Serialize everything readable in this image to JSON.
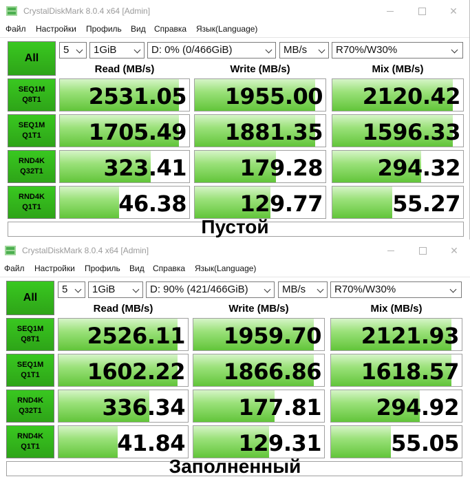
{
  "windows": [
    {
      "title": "CrystalDiskMark 8.0.4 x64 [Admin]",
      "menu": [
        "Файл",
        "Настройки",
        "Профиль",
        "Вид",
        "Справка",
        "Язык(Language)"
      ],
      "all_label": "All",
      "count": "5",
      "size": "1GiB",
      "drive": "D: 0% (0/466GiB)",
      "unit": "MB/s",
      "mix_mode": "R70%/W30%",
      "headers": [
        "Read (MB/s)",
        "Write (MB/s)",
        "Mix (MB/s)"
      ],
      "rows": [
        {
          "l1": "SEQ1M",
          "l2": "Q8T1",
          "read": "2531.05",
          "write": "1955.00",
          "mix": "2120.42",
          "fills": [
            0.92,
            0.92,
            0.92
          ]
        },
        {
          "l1": "SEQ1M",
          "l2": "Q1T1",
          "read": "1705.49",
          "write": "1881.35",
          "mix": "1596.33",
          "fills": [
            0.92,
            0.92,
            0.92
          ]
        },
        {
          "l1": "RND4K",
          "l2": "Q32T1",
          "read": "323.41",
          "write": "179.28",
          "mix": "294.32",
          "fills": [
            0.7,
            0.62,
            0.68
          ]
        },
        {
          "l1": "RND4K",
          "l2": "Q1T1",
          "read": "46.38",
          "write": "129.77",
          "mix": "55.27",
          "fills": [
            0.46,
            0.58,
            0.46
          ]
        }
      ],
      "overlay_text": "Пустой"
    },
    {
      "title": "CrystalDiskMark 8.0.4 x64 [Admin]",
      "menu": [
        "Файл",
        "Настройки",
        "Профиль",
        "Вид",
        "Справка",
        "Язык(Language)"
      ],
      "all_label": "All",
      "count": "5",
      "size": "1GiB",
      "drive": "D: 90% (421/466GiB)",
      "unit": "MB/s",
      "mix_mode": "R70%/W30%",
      "headers": [
        "Read (MB/s)",
        "Write (MB/s)",
        "Mix (MB/s)"
      ],
      "rows": [
        {
          "l1": "SEQ1M",
          "l2": "Q8T1",
          "read": "2526.11",
          "write": "1959.70",
          "mix": "2121.93",
          "fills": [
            0.92,
            0.92,
            0.92
          ]
        },
        {
          "l1": "SEQ1M",
          "l2": "Q1T1",
          "read": "1602.22",
          "write": "1866.86",
          "mix": "1618.57",
          "fills": [
            0.92,
            0.92,
            0.92
          ]
        },
        {
          "l1": "RND4K",
          "l2": "Q32T1",
          "read": "336.34",
          "write": "177.81",
          "mix": "294.92",
          "fills": [
            0.7,
            0.62,
            0.68
          ]
        },
        {
          "l1": "RND4K",
          "l2": "Q1T1",
          "read": "41.84",
          "write": "129.31",
          "mix": "55.05",
          "fills": [
            0.46,
            0.58,
            0.46
          ]
        }
      ],
      "overlay_text": "Заполненный"
    }
  ],
  "colors": {
    "button_green": "#34b81c",
    "bar_green": "#62c53a"
  }
}
